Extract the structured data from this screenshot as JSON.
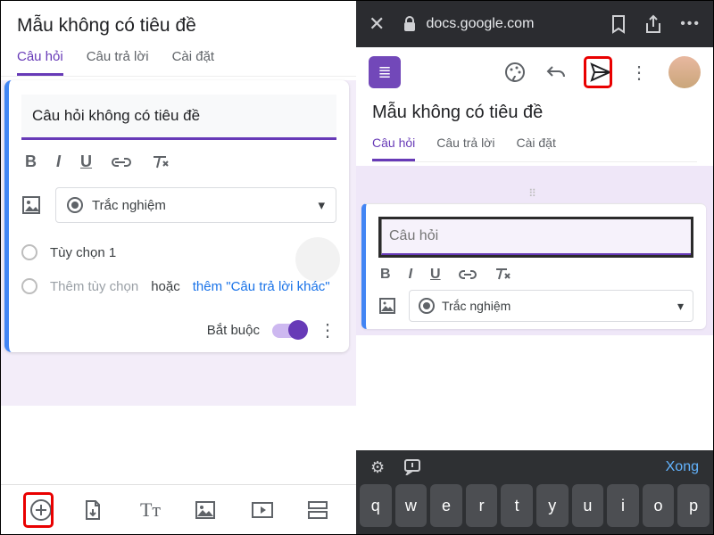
{
  "left": {
    "form_title": "Mẫu không có tiêu đề",
    "tabs": {
      "questions": "Câu hỏi",
      "responses": "Câu trả lời",
      "settings": "Cài đặt"
    },
    "question_placeholder": "Câu hỏi không có tiêu đề",
    "type_label": "Trắc nghiệm",
    "option1": "Tùy chọn 1",
    "add_option": "Thêm tùy chọn",
    "or_word": "hoặc",
    "add_other": "thêm \"Câu trả lời khác\"",
    "required_label": "Bắt buộc"
  },
  "right": {
    "url": "docs.google.com",
    "form_title": "Mẫu không có tiêu đề",
    "tabs": {
      "questions": "Câu hỏi",
      "responses": "Câu trả lời",
      "settings": "Cài đặt"
    },
    "question_placeholder": "Câu hỏi",
    "type_label": "Trắc nghiệm",
    "done": "Xong",
    "keys": [
      "q",
      "w",
      "e",
      "r",
      "t",
      "y",
      "u",
      "i",
      "o",
      "p"
    ]
  }
}
